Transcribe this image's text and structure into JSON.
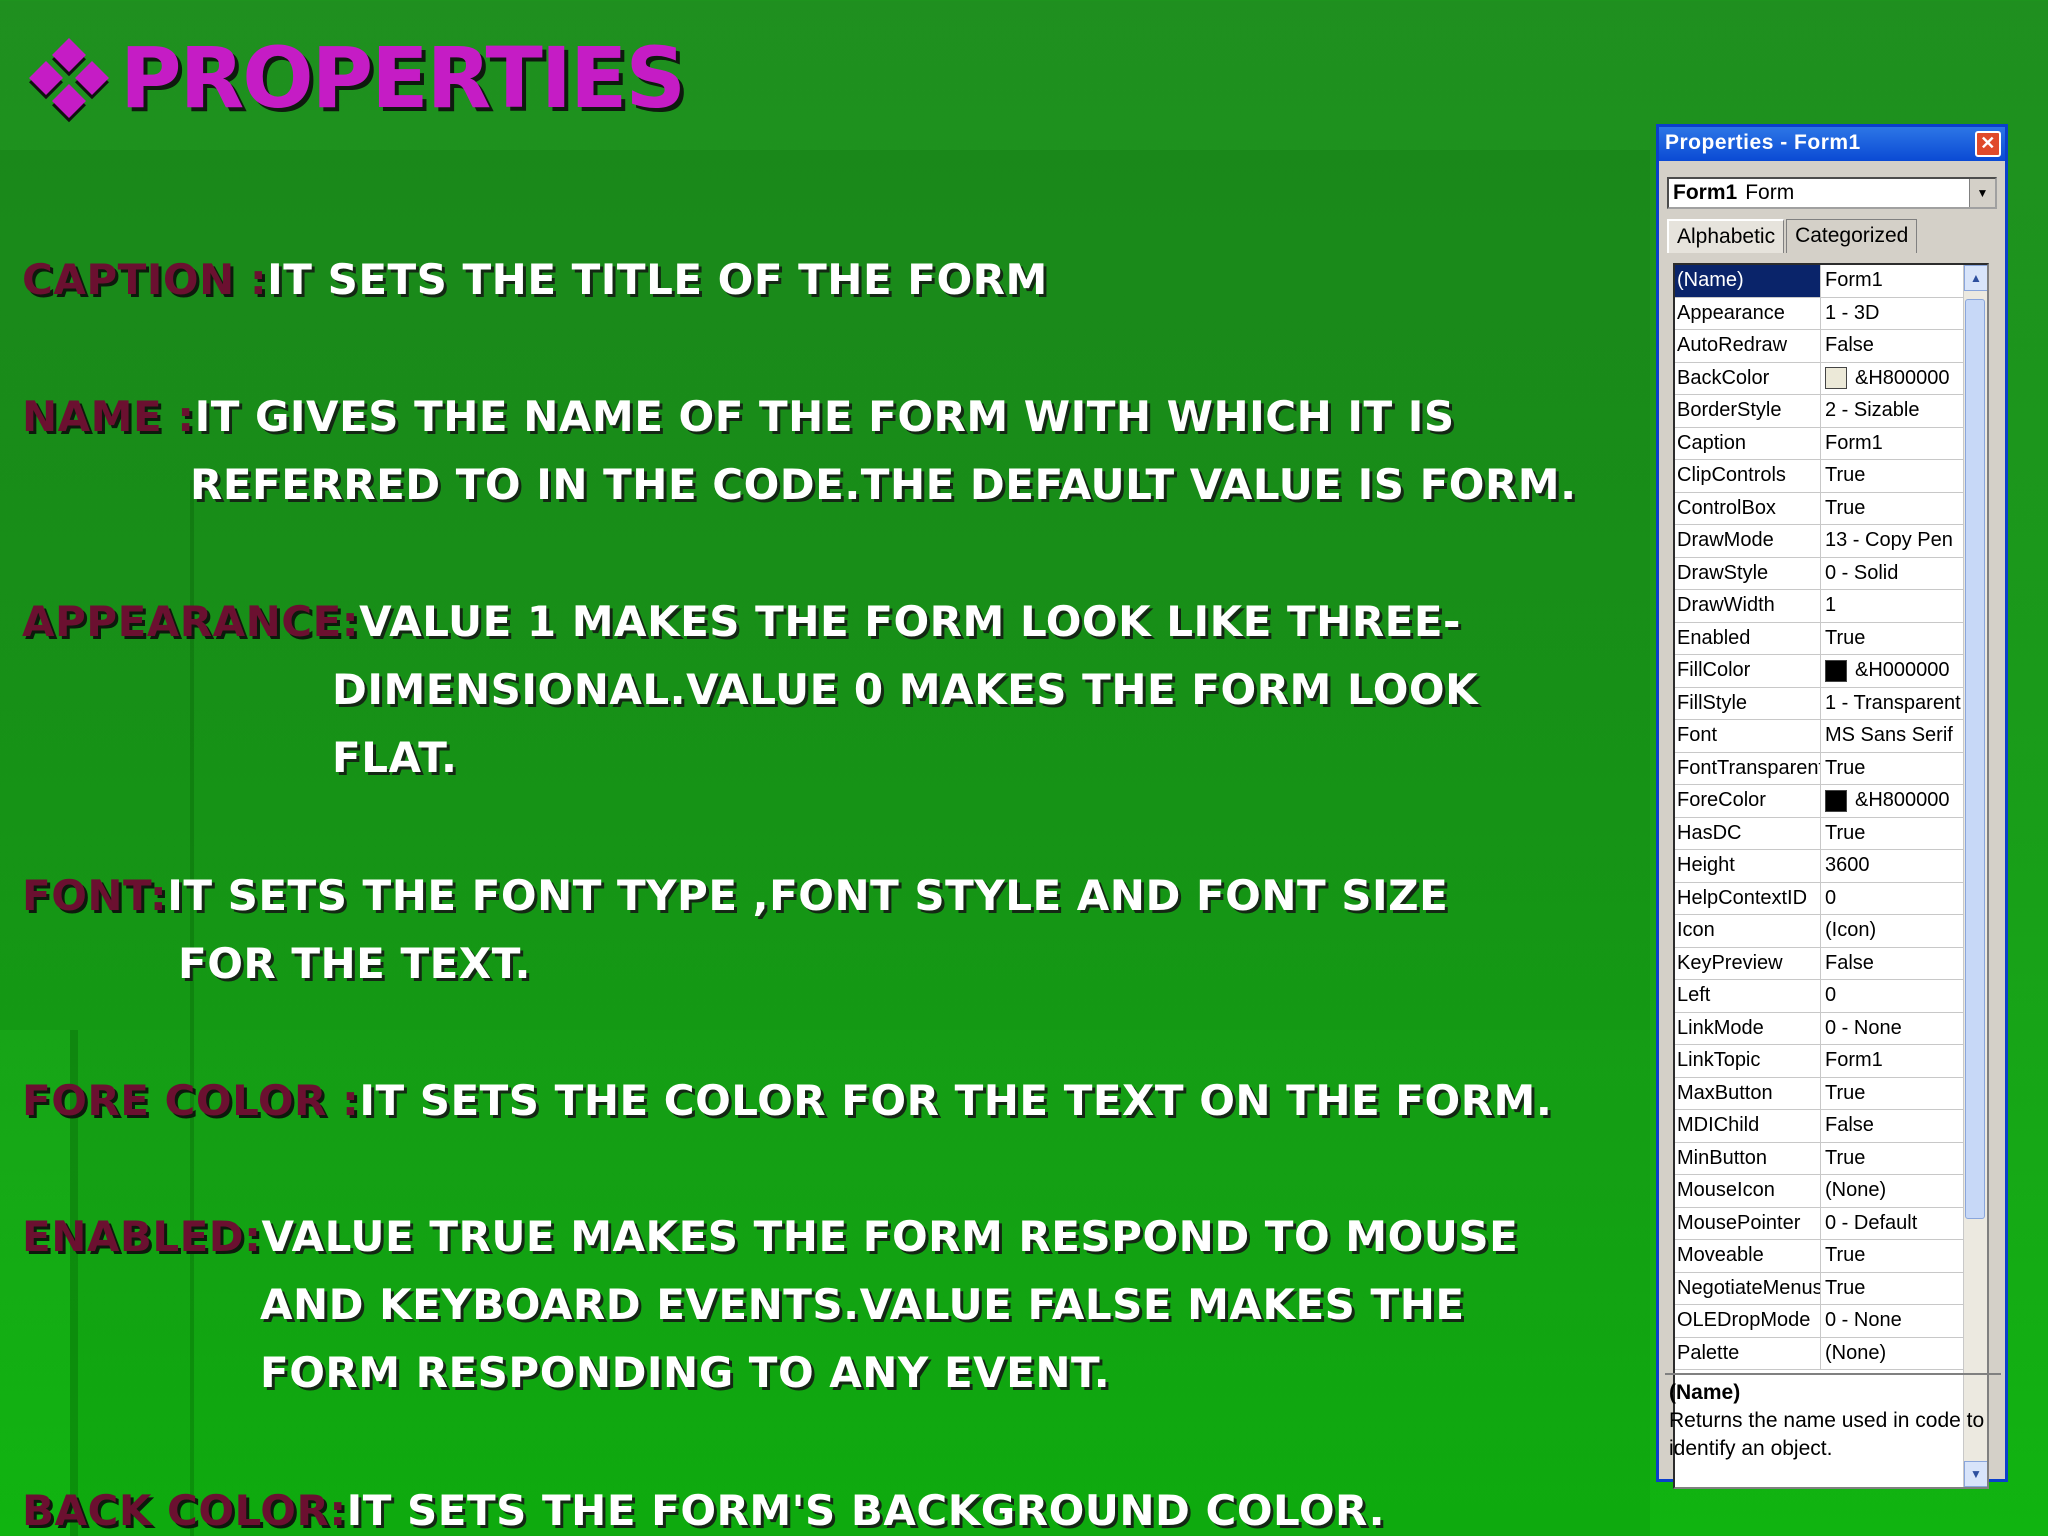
{
  "slide": {
    "title": "PROPERTIES",
    "items": [
      {
        "term": "CAPTION :",
        "lines": [
          "IT SETS THE TITLE OF THE FORM"
        ]
      },
      {
        "term": "NAME :",
        "lines": [
          "IT GIVES THE NAME OF THE FORM WITH WHICH IT IS",
          "REFERRED TO IN THE CODE.THE DEFAULT VALUE IS FORM."
        ]
      },
      {
        "term": "APPEARANCE:",
        "lines": [
          "VALUE 1 MAKES THE FORM LOOK LIKE THREE-",
          "DIMENSIONAL.VALUE 0 MAKES THE FORM LOOK",
          "FLAT."
        ]
      },
      {
        "term": "FONT:",
        "lines": [
          "IT SETS THE FONT TYPE ,FONT STYLE AND FONT SIZE",
          "FOR THE TEXT."
        ]
      },
      {
        "term": "FORE COLOR :",
        "lines": [
          "IT SETS THE COLOR FOR THE TEXT ON THE FORM."
        ]
      },
      {
        "term": "ENABLED:",
        "lines": [
          "VALUE TRUE MAKES THE FORM RESPOND TO  MOUSE",
          "AND KEYBOARD EVENTS.VALUE FALSE MAKES THE",
          "FORM RESPONDING TO ANY EVENT."
        ]
      },
      {
        "term": "BACK COLOR:",
        "lines": [
          "IT SETS THE FORM'S BACKGROUND COLOR."
        ]
      }
    ]
  },
  "properties_window": {
    "title": "Properties - Form1",
    "close_glyph": "✕",
    "object_name": "Form1",
    "object_type": "Form",
    "tabs": [
      "Alphabetic",
      "Categorized"
    ],
    "rows": [
      {
        "name": "(Name)",
        "value": "Form1"
      },
      {
        "name": "Appearance",
        "value": "1 - 3D"
      },
      {
        "name": "AutoRedraw",
        "value": "False"
      },
      {
        "name": "BackColor",
        "value": "&H800000",
        "swatch": "#ece9d8"
      },
      {
        "name": "BorderStyle",
        "value": "2 - Sizable"
      },
      {
        "name": "Caption",
        "value": "Form1"
      },
      {
        "name": "ClipControls",
        "value": "True"
      },
      {
        "name": "ControlBox",
        "value": "True"
      },
      {
        "name": "DrawMode",
        "value": "13 - Copy Pen"
      },
      {
        "name": "DrawStyle",
        "value": "0 - Solid"
      },
      {
        "name": "DrawWidth",
        "value": "1"
      },
      {
        "name": "Enabled",
        "value": "True"
      },
      {
        "name": "FillColor",
        "value": "&H000000",
        "swatch": "#000000"
      },
      {
        "name": "FillStyle",
        "value": "1 - Transparent"
      },
      {
        "name": "Font",
        "value": "MS Sans Serif"
      },
      {
        "name": "FontTransparent",
        "value": "True"
      },
      {
        "name": "ForeColor",
        "value": "&H800000",
        "swatch": "#000000"
      },
      {
        "name": "HasDC",
        "value": "True"
      },
      {
        "name": "Height",
        "value": "3600"
      },
      {
        "name": "HelpContextID",
        "value": "0"
      },
      {
        "name": "Icon",
        "value": "(Icon)"
      },
      {
        "name": "KeyPreview",
        "value": "False"
      },
      {
        "name": "Left",
        "value": "0"
      },
      {
        "name": "LinkMode",
        "value": "0 - None"
      },
      {
        "name": "LinkTopic",
        "value": "Form1"
      },
      {
        "name": "MaxButton",
        "value": "True"
      },
      {
        "name": "MDIChild",
        "value": "False"
      },
      {
        "name": "MinButton",
        "value": "True"
      },
      {
        "name": "MouseIcon",
        "value": "(None)"
      },
      {
        "name": "MousePointer",
        "value": "0 - Default"
      },
      {
        "name": "Moveable",
        "value": "True"
      },
      {
        "name": "NegotiateMenus",
        "value": "True"
      },
      {
        "name": "OLEDropMode",
        "value": "0 - None"
      },
      {
        "name": "Palette",
        "value": "(None)"
      }
    ],
    "description": {
      "heading": "(Name)",
      "text": "Returns the name used in code to identify an object."
    }
  },
  "colors": {
    "title": "#c51cc5",
    "term": "#6b1030",
    "body_text": "#ffffff",
    "selection": "#0a246a"
  }
}
